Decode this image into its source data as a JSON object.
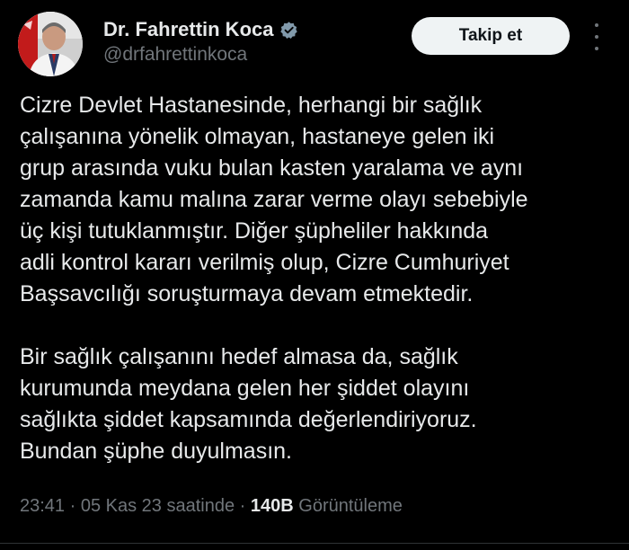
{
  "author": {
    "display_name": "Dr. Fahrettin Koca",
    "handle": "@drfahrettinkoca",
    "verified_icon": "verified-badge-icon",
    "avatar": "profile-photo"
  },
  "actions": {
    "follow_label": "Takip et",
    "more_icon": "more-dots-vertical-icon"
  },
  "tweet": {
    "paragraphs": [
      "Cizre Devlet Hastanesinde, herhangi bir sağlık\nçalışanına yönelik olmayan, hastaneye gelen iki\ngrup arasında vuku bulan kasten yaralama ve aynı\nzamanda kamu malına zarar verme olayı sebebiyle\nüç kişi tutuklanmıştır. Diğer şüpheliler hakkında\nadli kontrol kararı verilmiş olup, Cizre Cumhuriyet\nBaşsavcılığı soruşturmaya devam etmektedir.",
      "Bir sağlık çalışanını hedef almasa da, sağlık\nkurumunda meydana gelen her şiddet olayını\nsağlıkta şiddet kapsamında değerlendiriyoruz.\nBundan şüphe duyulmasın."
    ]
  },
  "meta": {
    "time": "23:41",
    "separator": "·",
    "date": "05 Kas 23 saatinde",
    "views_count": "140B",
    "views_label": "Görüntüleme"
  },
  "colors": {
    "background": "#000000",
    "text_primary": "#e7e9ea",
    "text_secondary": "#71767b",
    "verified_badge": "#829aab",
    "follow_button_bg": "#eff3f4",
    "follow_button_text": "#0f1419"
  }
}
